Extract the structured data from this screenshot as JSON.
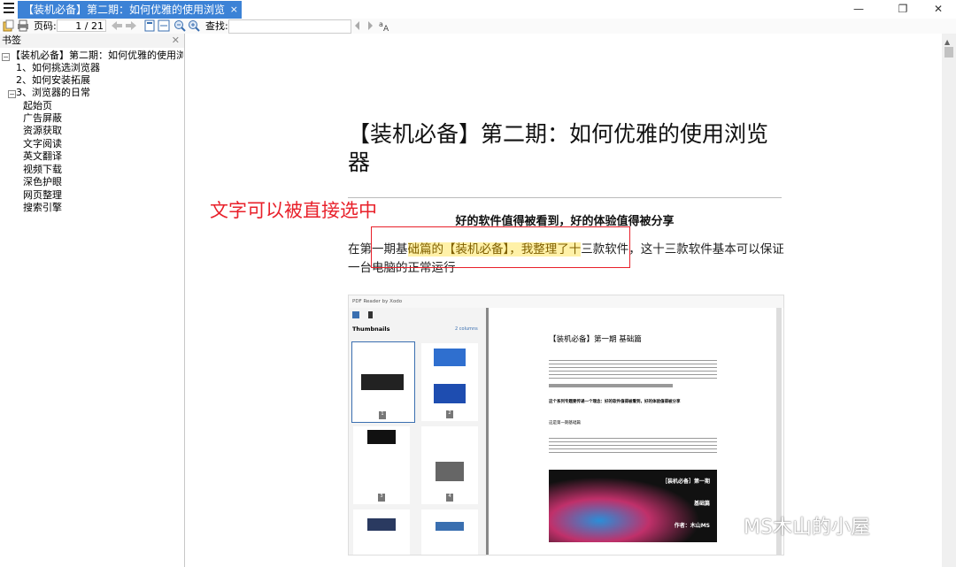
{
  "tab": {
    "title": "【装机必备】第二期：如何优雅的使用浏览器.pdf",
    "close": "×"
  },
  "window": {
    "minimize": "—",
    "restore": "❐",
    "close": "✕"
  },
  "toolbar": {
    "page_label": "页码:",
    "page_value": "1 / 21",
    "find_label": "查找:"
  },
  "sidebar": {
    "title": "书签",
    "close": "✕",
    "root": "【装机必备】第二期：如何优雅的使用浏览器",
    "items": [
      {
        "label": "1、如何挑选浏览器"
      },
      {
        "label": "2、如何安装拓展"
      },
      {
        "label": "3、浏览器的日常"
      }
    ],
    "subitems": [
      {
        "label": "起始页"
      },
      {
        "label": "广告屏蔽"
      },
      {
        "label": "资源获取"
      },
      {
        "label": "文字阅读"
      },
      {
        "label": "英文翻译"
      },
      {
        "label": "视频下载"
      },
      {
        "label": "深色护眼"
      },
      {
        "label": "网页整理"
      },
      {
        "label": "搜索引擎"
      }
    ]
  },
  "document": {
    "title": "【装机必备】第二期：如何优雅的使用浏览器",
    "subtitle": "好的软件值得被看到，好的体验值得被分享",
    "para_a": "在第一期基",
    "para_hl": "础篇的【装机必备】，我整理了十",
    "para_b": "三款软件，这十三款软件基本可以保证一台电脑的正常运行"
  },
  "annotation": "文字可以被直接选中",
  "inner": {
    "app_title": "PDF Reader by Xodo",
    "thumbs_label": "Thumbnails",
    "columns": "2 columns",
    "thumb_numbers": [
      "1",
      "2",
      "3",
      "4"
    ],
    "doc_title": "【装机必备】第一期 基础篇",
    "bold_line": "这个系列专题要传递一个理念：好的软件值得被看到，好的体验值得被分享",
    "section": "这是第一期基础篇",
    "banner_line1": "［装机必备］第一期",
    "banner_line2": "基础篇",
    "banner_line3": "作者：木山MS"
  },
  "watermark": "MS木山的小屋",
  "colors": {
    "tab": "#3c82d6",
    "annotation": "#e8202a",
    "highlight": "#fff1a8"
  }
}
